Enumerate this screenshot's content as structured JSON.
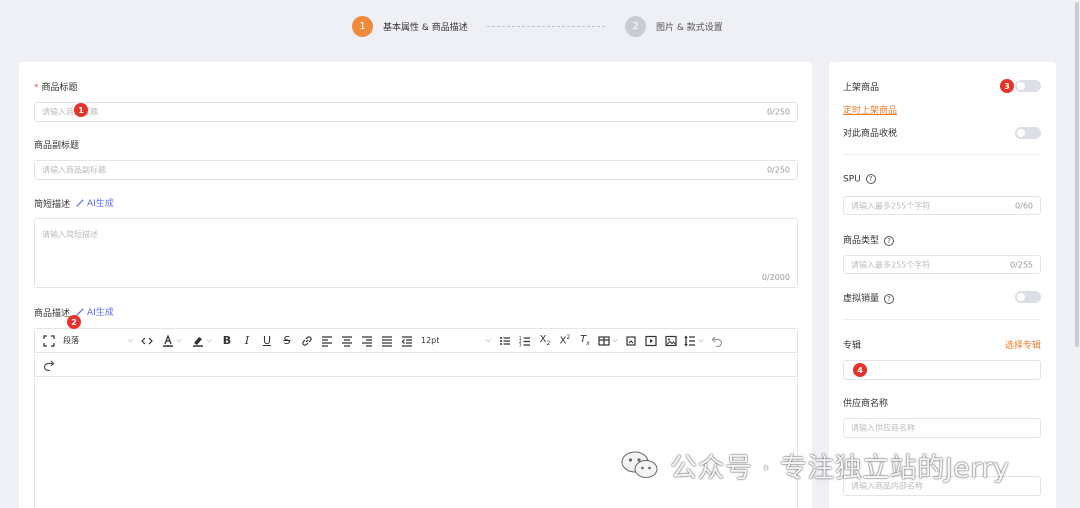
{
  "steps": [
    {
      "num": "1",
      "label": "基本属性 & 商品描述"
    },
    {
      "num": "2",
      "label": "图片 & 款式设置"
    }
  ],
  "main": {
    "title_label": "商品标题",
    "title_required": "*",
    "title_placeholder": "请输入商品标题",
    "title_count": "0/250",
    "subtitle_label": "商品副标题",
    "subtitle_placeholder": "请输入商品副标题",
    "subtitle_count": "0/250",
    "short_desc_label": "简短描述",
    "ai_label": "AI生成",
    "short_desc_placeholder": "请输入简短描述",
    "short_desc_count": "0/2000",
    "desc_label": "商品描述",
    "ai_label_2": "AI生成"
  },
  "editor": {
    "paragraph_select": "段落",
    "font_size_select": "12pt"
  },
  "side": {
    "publish_label": "上架商品",
    "schedule_link": "定时上架商品",
    "tax_label": "对此商品收税",
    "spu_label": "SPU",
    "spu_placeholder": "请输入最多255个字符",
    "spu_count": "0/60",
    "type_label": "商品类型",
    "type_placeholder": "请输入最多255个字符",
    "type_count": "0/255",
    "virtual_sales_label": "虚拟销量",
    "album_label": "专辑",
    "album_select_link": "选择专辑",
    "supplier_label": "供应商名称",
    "supplier_placeholder": "请输入供应商名称",
    "inner_name_placeholder": "请输入商品内部名称"
  },
  "badges": [
    "1",
    "2",
    "3",
    "4"
  ],
  "watermark": "公众号 · 专注独立站的Jerry",
  "colors": {
    "accent": "#ef8a3c",
    "badge": "#e8332a",
    "ai": "#5b6cf0"
  }
}
